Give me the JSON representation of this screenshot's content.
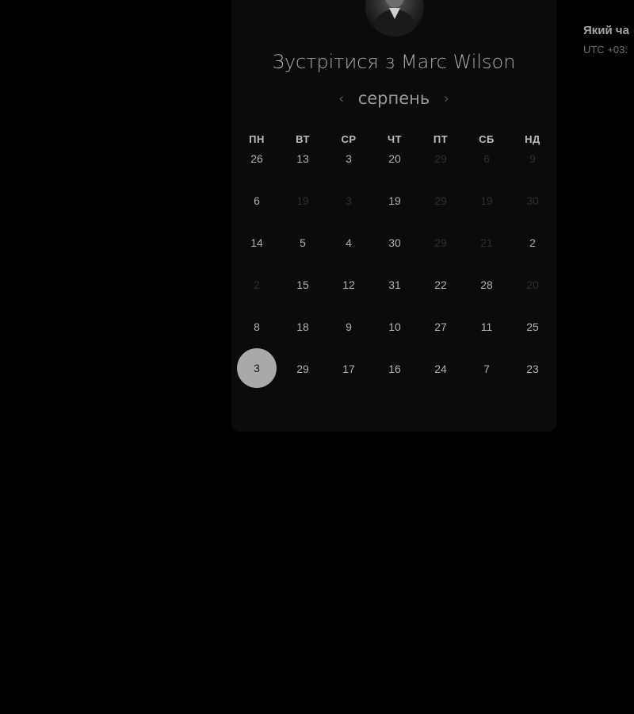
{
  "booking": {
    "title": "Зустрітися з Marc Wilson",
    "host_avatar": "host-photo"
  },
  "calendar": {
    "month": "серпень",
    "prev_icon": "chevron-left-icon",
    "next_icon": "chevron-right-icon",
    "weekdays": [
      "ПН",
      "ВТ",
      "СР",
      "ЧТ",
      "ПТ",
      "СБ",
      "НД"
    ],
    "weeks": [
      [
        {
          "label": "26",
          "available": true
        },
        {
          "label": "13",
          "available": true
        },
        {
          "label": "3",
          "available": true
        },
        {
          "label": "20",
          "available": true
        },
        {
          "label": "29",
          "available": false
        },
        {
          "label": "6",
          "available": false
        },
        {
          "label": "9",
          "available": false
        }
      ],
      [
        {
          "label": "6",
          "available": true
        },
        {
          "label": "19",
          "available": false
        },
        {
          "label": "3",
          "available": false
        },
        {
          "label": "19",
          "available": true
        },
        {
          "label": "29",
          "available": false
        },
        {
          "label": "19",
          "available": false
        },
        {
          "label": "30",
          "available": false
        }
      ],
      [
        {
          "label": "14",
          "available": true
        },
        {
          "label": "5",
          "available": true
        },
        {
          "label": "4",
          "available": true
        },
        {
          "label": "30",
          "available": true
        },
        {
          "label": "29",
          "available": false
        },
        {
          "label": "21",
          "available": false
        },
        {
          "label": "2",
          "available": true
        }
      ],
      [
        {
          "label": "2",
          "available": false
        },
        {
          "label": "15",
          "available": true
        },
        {
          "label": "12",
          "available": true
        },
        {
          "label": "31",
          "available": true
        },
        {
          "label": "22",
          "available": true
        },
        {
          "label": "28",
          "available": true
        },
        {
          "label": "20",
          "available": false
        }
      ],
      [
        {
          "label": "8",
          "available": true
        },
        {
          "label": "18",
          "available": true
        },
        {
          "label": "9",
          "available": true
        },
        {
          "label": "10",
          "available": true
        },
        {
          "label": "27",
          "available": true
        },
        {
          "label": "11",
          "available": true
        },
        {
          "label": "25",
          "available": true
        }
      ],
      [
        {
          "label": "3",
          "available": true,
          "selected": true
        },
        {
          "label": "29",
          "available": true
        },
        {
          "label": "17",
          "available": true
        },
        {
          "label": "16",
          "available": true
        },
        {
          "label": "24",
          "available": true
        },
        {
          "label": "7",
          "available": true
        },
        {
          "label": "23",
          "available": true
        }
      ]
    ]
  },
  "timezone": {
    "title": "Який ча",
    "value": "UTC +03:"
  },
  "colors": {
    "background": "#000000",
    "card": "#0b0b0b",
    "selected_day": "#a9a9a9"
  }
}
